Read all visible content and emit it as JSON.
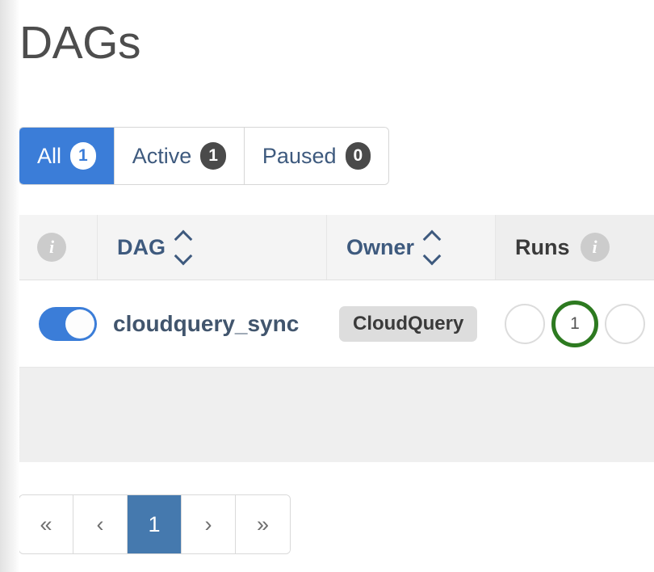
{
  "header": {
    "title": "DAGs"
  },
  "tabs": [
    {
      "label": "All",
      "count": "1",
      "active": true
    },
    {
      "label": "Active",
      "count": "1",
      "active": false
    },
    {
      "label": "Paused",
      "count": "0",
      "active": false
    }
  ],
  "table": {
    "columns": {
      "info": "",
      "dag": "DAG",
      "owner": "Owner",
      "runs": "Runs"
    },
    "rows": [
      {
        "paused_toggle_state": "on",
        "dag_id": "cloudquery_sync",
        "owner": "CloudQuery",
        "runs": [
          {
            "status": "none",
            "count": ""
          },
          {
            "status": "success",
            "count": "1"
          },
          {
            "status": "none",
            "count": ""
          }
        ]
      }
    ]
  },
  "pagination": {
    "first": "«",
    "previous": "‹",
    "pages": [
      {
        "label": "1",
        "active": true
      }
    ],
    "next": "›",
    "last": "»"
  },
  "colors": {
    "accent_blue": "#3b7dd8",
    "pagination_active": "#4579ae",
    "link_blue": "#3e5a7e",
    "badge_dark": "#4a4a4a",
    "owner_badge_bg": "#dddddd",
    "success_green": "#2d7a20",
    "title_gray": "#4d4d4d",
    "table_bg": "#efefef",
    "header_bg": "#f4f4f4"
  }
}
